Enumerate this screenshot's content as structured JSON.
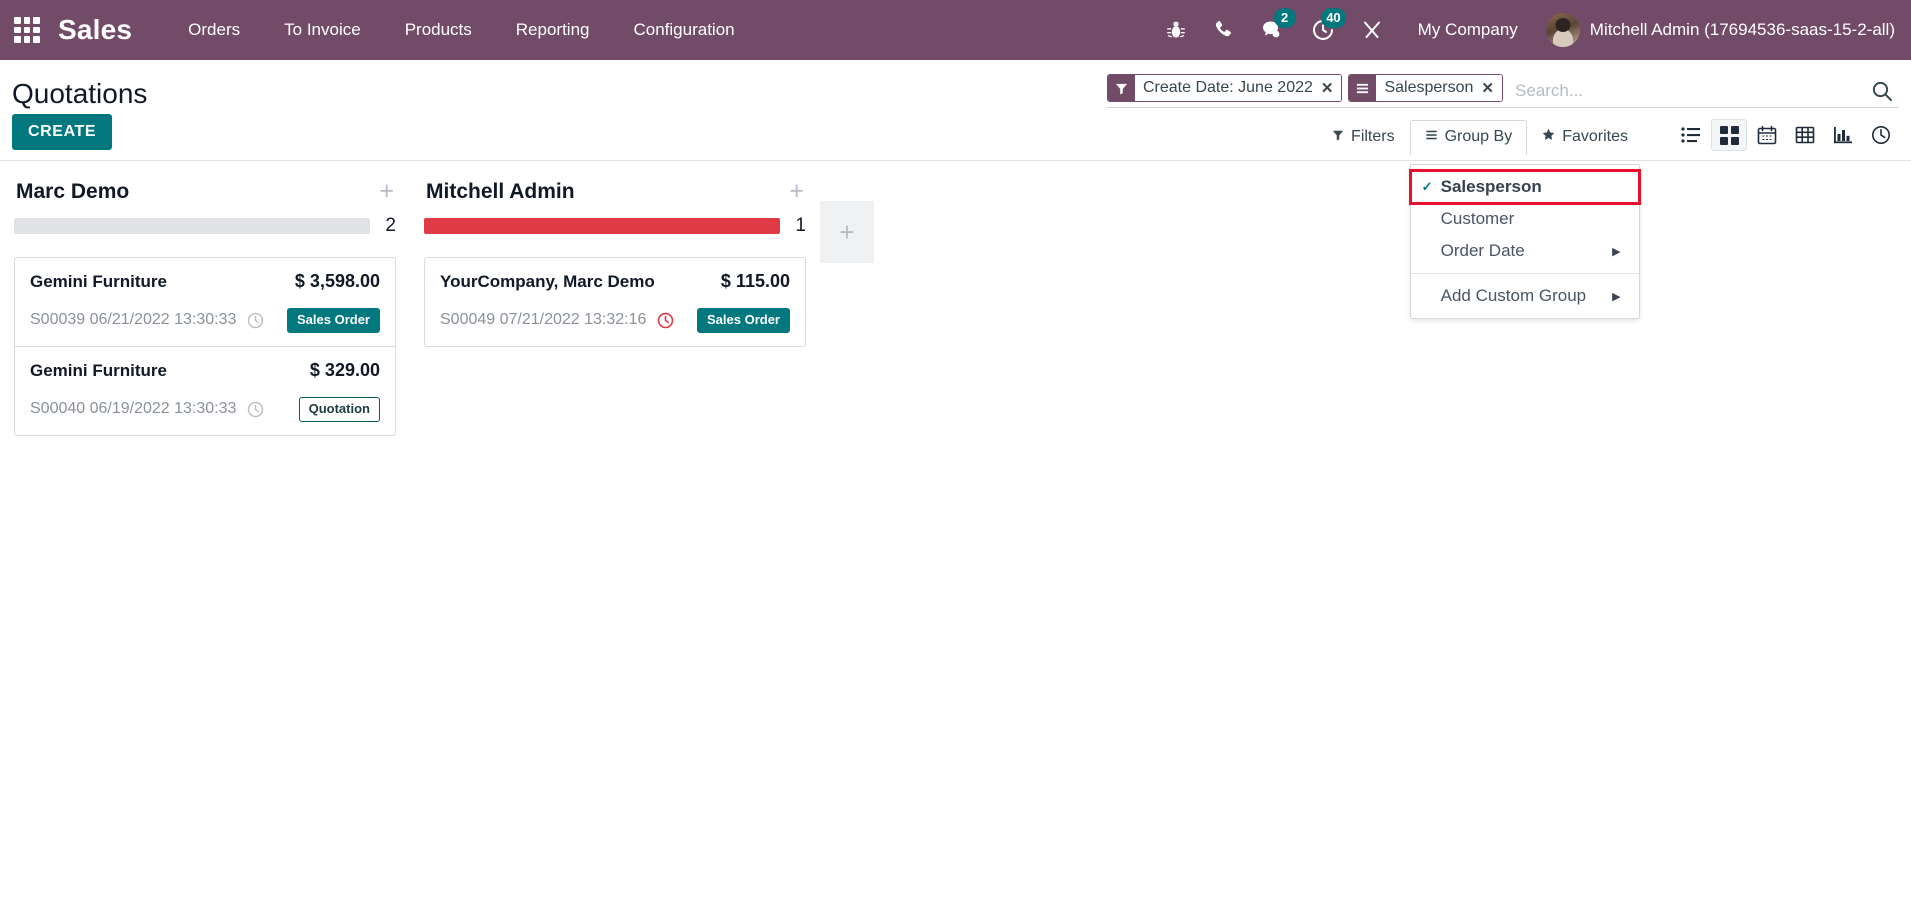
{
  "navbar": {
    "apps_icon": "apps-grid-icon",
    "brand": "Sales",
    "menu": [
      {
        "label": "Orders"
      },
      {
        "label": "To Invoice"
      },
      {
        "label": "Products"
      },
      {
        "label": "Reporting"
      },
      {
        "label": "Configuration"
      }
    ],
    "icons": [
      {
        "name": "bug-icon",
        "badge": null
      },
      {
        "name": "phone-icon",
        "badge": null
      },
      {
        "name": "messages-icon",
        "badge": "2"
      },
      {
        "name": "activities-clock-icon",
        "badge": "40"
      },
      {
        "name": "tools-icon",
        "badge": null
      }
    ],
    "company": "My Company",
    "user": "Mitchell Admin (17694536-saas-15-2-all)",
    "brand_color": "#714B67",
    "badge_color": "#00787E"
  },
  "control_panel": {
    "page_title": "Quotations",
    "create_label": "CREATE",
    "create_color": "#00787E",
    "search": {
      "placeholder": "Search...",
      "search_icon": "magnifier-icon",
      "facets": [
        {
          "icon": "filter-funnel-icon",
          "label": "Create Date: June 2022",
          "remove": "✕"
        },
        {
          "icon": "group-lines-icon",
          "label": "Salesperson",
          "remove": "✕"
        }
      ]
    },
    "toggles": [
      {
        "name": "filters",
        "label": "Filters",
        "icon": "filter-funnel-icon",
        "open": false
      },
      {
        "name": "group-by",
        "label": "Group By",
        "icon": "group-lines-icon",
        "open": true
      },
      {
        "name": "favorites",
        "label": "Favorites",
        "icon": "star-icon",
        "open": false
      }
    ],
    "group_by_menu": {
      "items": [
        {
          "label": "Salesperson",
          "selected": true,
          "submenu": false,
          "highlighted": true
        },
        {
          "label": "Customer",
          "selected": false,
          "submenu": false,
          "highlighted": false
        },
        {
          "label": "Order Date",
          "selected": false,
          "submenu": true,
          "highlighted": false
        }
      ],
      "custom": {
        "label": "Add Custom Group",
        "submenu": true
      },
      "highlight_color": "#e8112d",
      "check_color": "#00787E"
    },
    "views": [
      {
        "name": "list-view",
        "icon": "list-icon",
        "active": false
      },
      {
        "name": "kanban-view",
        "icon": "kanban-grid-icon",
        "active": true
      },
      {
        "name": "calendar-view",
        "icon": "calendar-icon",
        "active": false
      },
      {
        "name": "pivot-view",
        "icon": "pivot-table-icon",
        "active": false
      },
      {
        "name": "graph-view",
        "icon": "bar-chart-icon",
        "active": false
      },
      {
        "name": "activity-view",
        "icon": "clock-icon",
        "active": false
      }
    ]
  },
  "kanban": {
    "columns": [
      {
        "title": "Marc Demo",
        "count": "2",
        "progress_color": "#e0e2e5",
        "progress_pct": 100,
        "add_icon": "plus-icon",
        "cards": [
          {
            "customer": "Gemini Furniture",
            "amount": "$ 3,598.00",
            "reference": "S00039 06/21/2022 13:30:33",
            "clock": {
              "name": "clock-icon",
              "color": "#b9bec4"
            },
            "state": {
              "label": "Sales Order",
              "style": "sales-order"
            }
          },
          {
            "customer": "Gemini Furniture",
            "amount": "$ 329.00",
            "reference": "S00040 06/19/2022 13:30:33",
            "clock": {
              "name": "clock-icon",
              "color": "#b9bec4"
            },
            "state": {
              "label": "Quotation",
              "style": "quotation"
            }
          }
        ]
      },
      {
        "title": "Mitchell Admin",
        "count": "1",
        "progress_color": "#e03a47",
        "progress_pct": 100,
        "add_icon": "plus-icon",
        "cards": [
          {
            "customer": "YourCompany, Marc Demo",
            "amount": "$ 115.00",
            "reference": "S00049 07/21/2022 13:32:16",
            "clock": {
              "name": "clock-icon",
              "color": "#e03a47"
            },
            "state": {
              "label": "Sales Order",
              "style": "sales-order"
            }
          }
        ]
      }
    ],
    "add_column": {
      "icon": "plus-icon"
    }
  }
}
